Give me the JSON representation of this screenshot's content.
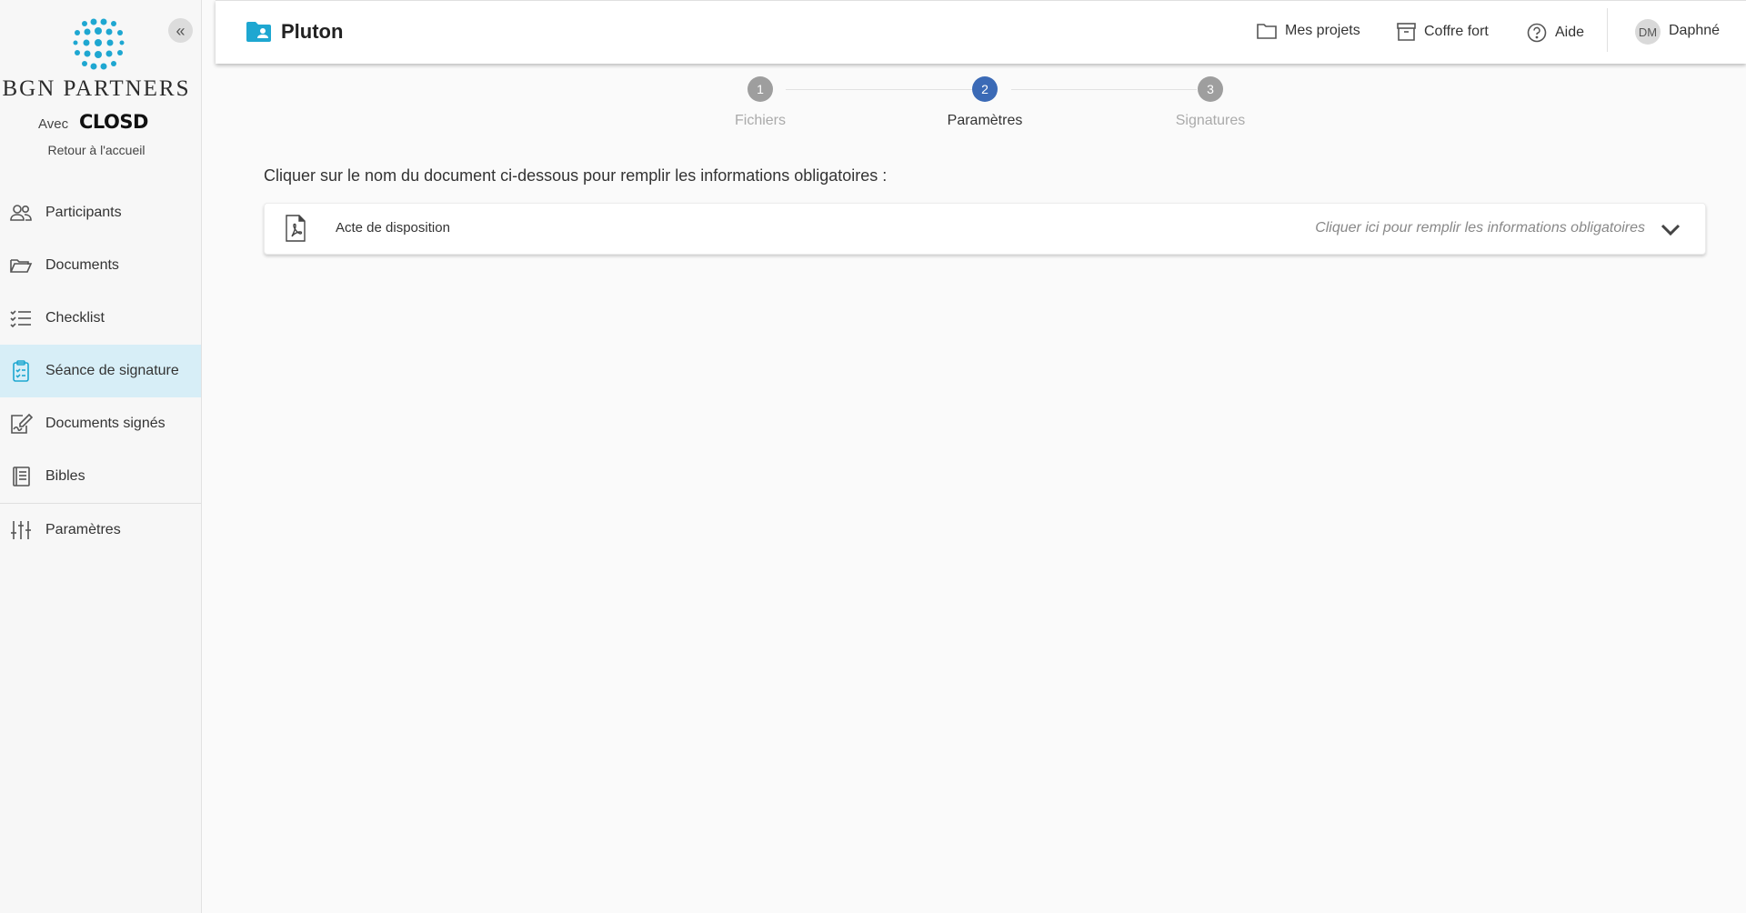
{
  "sidebar": {
    "brand": "BGN PARTNERS",
    "avec": "Avec",
    "partner_logo": "CLOSD",
    "back_home": "Retour à l'accueil",
    "collapse_icon": "double-chevron-left-icon",
    "items": [
      {
        "label": "Participants",
        "icon": "users-icon",
        "active": false
      },
      {
        "label": "Documents",
        "icon": "folder-open-icon",
        "active": false
      },
      {
        "label": "Checklist",
        "icon": "checklist-icon",
        "active": false
      },
      {
        "label": "Séance de signature",
        "icon": "clipboard-icon",
        "active": true
      },
      {
        "label": "Documents signés",
        "icon": "signed-document-icon",
        "active": false
      },
      {
        "label": "Bibles",
        "icon": "book-icon",
        "active": false
      },
      {
        "label": "Paramètres",
        "icon": "sliders-icon",
        "active": false
      }
    ]
  },
  "header": {
    "project_title": "Pluton",
    "links": {
      "projects": "Mes projets",
      "vault": "Coffre fort",
      "help": "Aide"
    },
    "user": {
      "initials": "DM",
      "name": "Daphné"
    }
  },
  "stepper": {
    "steps": [
      {
        "number": "1",
        "label": "Fichiers",
        "active": false
      },
      {
        "number": "2",
        "label": "Paramètres",
        "active": true
      },
      {
        "number": "3",
        "label": "Signatures",
        "active": false
      }
    ]
  },
  "main": {
    "instruction": "Cliquer sur le nom du document ci-dessous pour remplir les informations obligatoires :",
    "document": {
      "name": "Acte de disposition",
      "hint": "Cliquer ici pour remplir les informations obligatoires",
      "icon": "pdf-file-icon"
    }
  },
  "colors": {
    "accent": "#1ea7d1",
    "active_nav_bg": "#d7eef7",
    "step_active": "#3b6ab6",
    "step_inactive": "#9e9e9e"
  }
}
